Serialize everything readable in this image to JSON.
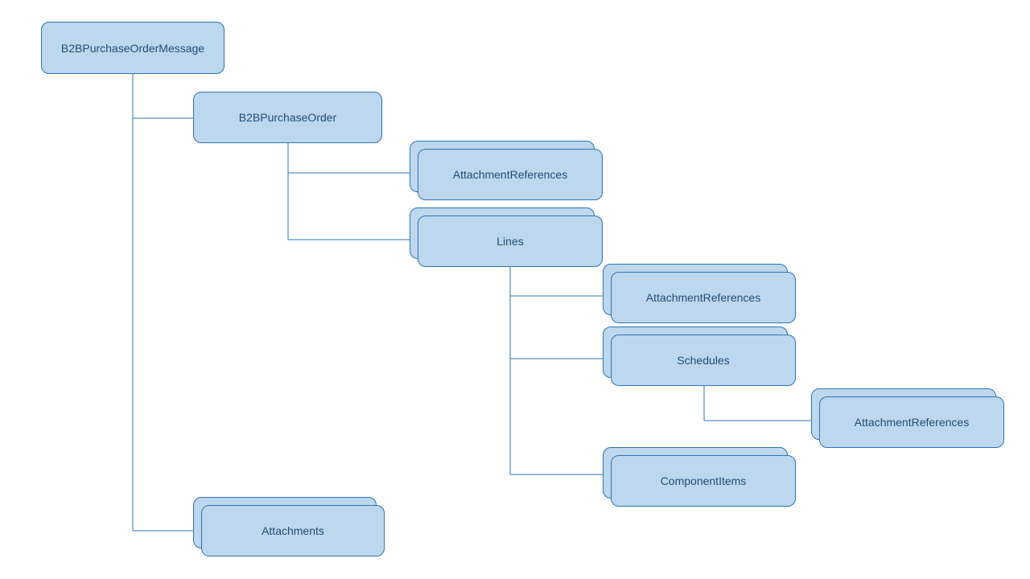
{
  "diagram": {
    "type": "hierarchy",
    "nodes": {
      "root": {
        "label": "B2BPurchaseOrderMessage"
      },
      "order": {
        "label": "B2BPurchaseOrder"
      },
      "order_attrefs": {
        "label": "AttachmentReferences"
      },
      "lines": {
        "label": "Lines"
      },
      "lines_attrefs": {
        "label": "AttachmentReferences"
      },
      "schedules": {
        "label": "Schedules"
      },
      "sched_attrefs": {
        "label": "AttachmentReferences"
      },
      "components": {
        "label": "ComponentItems"
      },
      "attachments": {
        "label": "Attachments"
      }
    },
    "edges": [
      [
        "root",
        "order"
      ],
      [
        "root",
        "attachments"
      ],
      [
        "order",
        "order_attrefs"
      ],
      [
        "order",
        "lines"
      ],
      [
        "lines",
        "lines_attrefs"
      ],
      [
        "lines",
        "schedules"
      ],
      [
        "lines",
        "components"
      ],
      [
        "schedules",
        "sched_attrefs"
      ]
    ],
    "stacked": [
      "order_attrefs",
      "lines",
      "lines_attrefs",
      "schedules",
      "sched_attrefs",
      "components",
      "attachments"
    ]
  }
}
